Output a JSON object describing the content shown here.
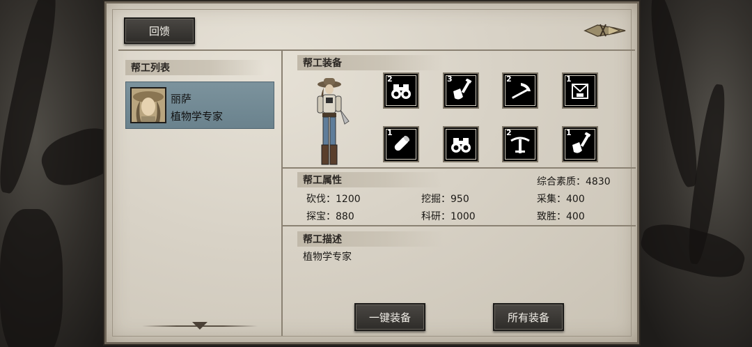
{
  "header": {
    "feedback_label": "回馈"
  },
  "helper_list": {
    "title": "帮工列表",
    "helpers": [
      {
        "name": "丽萨",
        "role": "植物学专家"
      }
    ]
  },
  "equipment": {
    "title": "帮工装备",
    "slots": [
      {
        "icon": "binoculars-icon",
        "count": "2"
      },
      {
        "icon": "shovel-icon",
        "count": "3"
      },
      {
        "icon": "pickaxe-icon",
        "count": "2"
      },
      {
        "icon": "bucket-icon",
        "count": "1"
      },
      {
        "icon": "scroll-icon",
        "count": "1"
      },
      {
        "icon": "binoculars-icon",
        "count": ""
      },
      {
        "icon": "crossbow-icon",
        "count": "2"
      },
      {
        "icon": "shovel-icon",
        "count": "1"
      }
    ]
  },
  "attributes": {
    "title": "帮工属性",
    "overall": "综合素质：4830",
    "chop": "砍伐：1200",
    "dig": "挖掘：950",
    "gather": "采集：400",
    "treasure": "探宝：880",
    "research": "科研：1000",
    "victory": "致胜：400"
  },
  "description": {
    "title": "帮工描述",
    "text": "植物学专家"
  },
  "footer": {
    "equip_all_label": "一键装备",
    "all_equipment_label": "所有装备"
  },
  "colors": {
    "parchment": "#d8d2c6",
    "selected_card": "#7c939d",
    "button": "#3a3835"
  }
}
